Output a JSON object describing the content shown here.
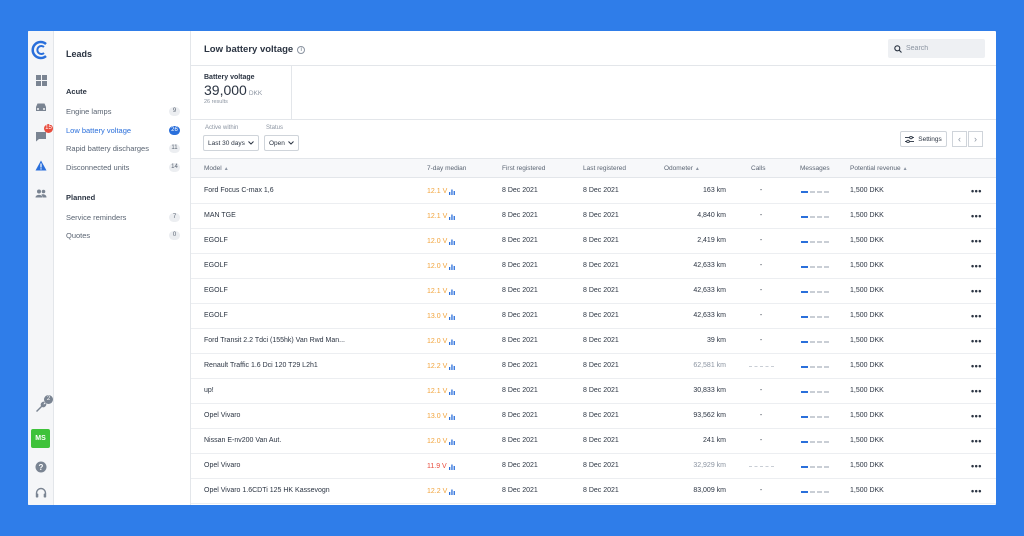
{
  "colors": {
    "background": "#2f7de9",
    "accent": "#2a6fdb",
    "orange": "#f2a33a",
    "red": "#e84c3d",
    "green": "#3ec23a"
  },
  "rail": {
    "icons": [
      "logo-icon",
      "dashboard-icon",
      "car-icon",
      "chat-icon",
      "warning-icon",
      "users-icon",
      "wrench-icon",
      "help-icon",
      "headset-icon"
    ],
    "chat_badge": "15",
    "wrench_badge": "2",
    "avatar": "MS"
  },
  "leads": {
    "title": "Leads",
    "acute_title": "Acute",
    "acute_items": [
      {
        "label": "Engine lamps",
        "count": "9"
      },
      {
        "label": "Low battery voltage",
        "count": "26"
      },
      {
        "label": "Rapid battery discharges",
        "count": "11"
      },
      {
        "label": "Disconnected units",
        "count": "14"
      }
    ],
    "planned_title": "Planned",
    "planned_items": [
      {
        "label": "Service reminders",
        "count": "7"
      },
      {
        "label": "Quotes",
        "count": "0"
      }
    ]
  },
  "header": {
    "title": "Low battery voltage",
    "search_placeholder": "Search"
  },
  "kpi": {
    "label": "Battery voltage",
    "value": "39,000",
    "unit": "DKK",
    "sub": "26 results"
  },
  "filters": {
    "active_label": "Active within",
    "active_value": "Last 30 days",
    "status_label": "Status",
    "status_value": "Open",
    "settings_label": "Settings"
  },
  "table": {
    "columns": [
      "Model",
      "7-day median",
      "First registered",
      "Last registered",
      "Odometer",
      "Calls",
      "Messages",
      "Potential revenue"
    ],
    "rows": [
      {
        "model": "Ford Focus C-max 1,6",
        "median": "12.1 V",
        "first": "8 Dec 2021",
        "last": "8 Dec 2021",
        "odometer": "163 km",
        "odo_muted": false,
        "calls": "-",
        "revenue": "1,500 DKK"
      },
      {
        "model": "MAN TGE",
        "median": "12.1 V",
        "first": "8 Dec 2021",
        "last": "8 Dec 2021",
        "odometer": "4,840 km",
        "odo_muted": false,
        "calls": "-",
        "revenue": "1,500 DKK"
      },
      {
        "model": "EGOLF",
        "median": "12.0 V",
        "first": "8 Dec 2021",
        "last": "8 Dec 2021",
        "odometer": "2,419 km",
        "odo_muted": false,
        "calls": "-",
        "revenue": "1,500 DKK"
      },
      {
        "model": "EGOLF",
        "median": "12.0 V",
        "first": "8 Dec 2021",
        "last": "8 Dec 2021",
        "odometer": "42,633 km",
        "odo_muted": false,
        "calls": "-",
        "revenue": "1,500 DKK"
      },
      {
        "model": "EGOLF",
        "median": "12.1 V",
        "first": "8 Dec 2021",
        "last": "8 Dec 2021",
        "odometer": "42,633 km",
        "odo_muted": false,
        "calls": "-",
        "revenue": "1,500 DKK"
      },
      {
        "model": "EGOLF",
        "median": "13.0 V",
        "first": "8 Dec 2021",
        "last": "8 Dec 2021",
        "odometer": "42,633 km",
        "odo_muted": false,
        "calls": "-",
        "revenue": "1,500 DKK"
      },
      {
        "model": "Ford Transit 2.2 Tdci (155hk) Van Rwd Man...",
        "median": "12.0 V",
        "first": "8 Dec 2021",
        "last": "8 Dec 2021",
        "odometer": "39 km",
        "odo_muted": false,
        "calls": "-",
        "revenue": "1,500 DKK"
      },
      {
        "model": "Renault Traffic 1.6 Dci 120 T29 L2h1",
        "median": "12.2 V",
        "first": "8 Dec 2021",
        "last": "8 Dec 2021",
        "odometer": "62,581 km",
        "odo_muted": true,
        "calls": "",
        "revenue": "1,500 DKK"
      },
      {
        "model": "up!",
        "median": "12.1 V",
        "first": "8 Dec 2021",
        "last": "8 Dec 2021",
        "odometer": "30,833 km",
        "odo_muted": false,
        "calls": "-",
        "revenue": "1,500 DKK"
      },
      {
        "model": "Opel Vivaro",
        "median": "13.0 V",
        "first": "8 Dec 2021",
        "last": "8 Dec 2021",
        "odometer": "93,562 km",
        "odo_muted": false,
        "calls": "-",
        "revenue": "1,500 DKK"
      },
      {
        "model": "Nissan E-nv200 Van Aut.",
        "median": "12.0 V",
        "first": "8 Dec 2021",
        "last": "8 Dec 2021",
        "odometer": "241 km",
        "odo_muted": false,
        "calls": "-",
        "revenue": "1,500 DKK"
      },
      {
        "model": "Opel Vivaro",
        "median": "11.9 V",
        "first": "8 Dec 2021",
        "last": "8 Dec 2021",
        "odometer": "32,929 km",
        "odo_muted": true,
        "calls": "",
        "revenue": "1,500 DKK"
      },
      {
        "model": "Opel Vivaro 1.6CDTi 125 HK Kassevogn",
        "median": "12.2 V",
        "first": "8 Dec 2021",
        "last": "8 Dec 2021",
        "odometer": "83,009 km",
        "odo_muted": false,
        "calls": "-",
        "revenue": "1,500 DKK"
      }
    ]
  }
}
